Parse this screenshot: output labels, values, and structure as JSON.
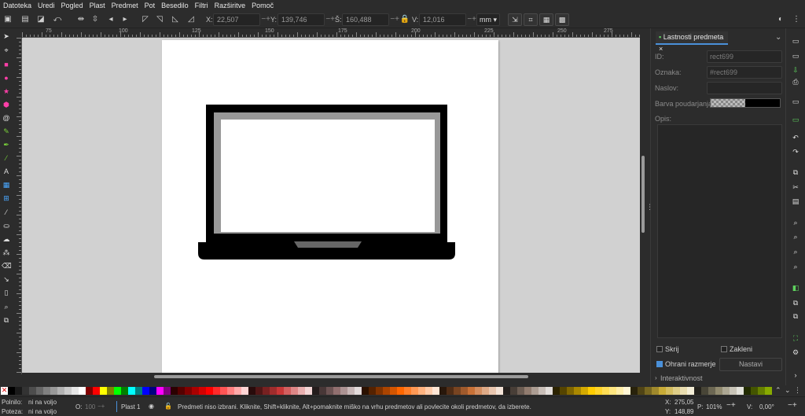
{
  "menu": [
    "Datoteka",
    "Uredi",
    "Pogled",
    "Plast",
    "Predmet",
    "Pot",
    "Besedilo",
    "Filtri",
    "Razširitve",
    "Pomoč"
  ],
  "controls": {
    "x_label": "X:",
    "x_value": "22,507",
    "y_label": "Y:",
    "y_value": "139,746",
    "w_label": "Š:",
    "w_value": "160,488",
    "h_label": "V:",
    "h_value": "12,016",
    "unit": "mm"
  },
  "ruler_top": [
    "75",
    "100",
    "125",
    "150",
    "175",
    "200",
    "225",
    "250",
    "275"
  ],
  "panel": {
    "tab_label": "Lastnosti predmeta",
    "tab_close": "×",
    "id_label": "ID:",
    "id_value": "rect699",
    "oznaka_label": "Oznaka:",
    "oznaka_value": "#rect699",
    "naslov_label": "Naslov:",
    "naslov_value": "",
    "highlight_label": "Barva poudarjanja:",
    "opis_label": "Opis:",
    "skrij": "Skrij",
    "zakleni": "Zakleni",
    "ohrani": "Ohrani razmerje",
    "nastavi": "Nastavi",
    "interaktivnost": "Interaktivnost"
  },
  "status": {
    "fill_label": "Polnilo:",
    "fill_value": "ni na voljo",
    "stroke_label": "Poteza:",
    "stroke_value": "ni na voljo",
    "opacity_label": "O:",
    "opacity_value": "100",
    "layer": "Plast 1",
    "message": "Predmeti niso izbrani. Kliknite, Shift+kliknite, Alt+pomaknite miško na vrhu predmetov ali povlecite okoli predmetov, da izberete.",
    "x_label": "X:",
    "x_value": "275,05",
    "y_label": "Y:",
    "y_value": "148,89",
    "zoom_label": "P:",
    "zoom_value": "101%",
    "rotate_label": "V:",
    "rotate_value": "0,00°"
  },
  "colors": {
    "accent": "#4a90d9",
    "canvas_bg": "#d1d1d1",
    "laptop_body": "#000000",
    "laptop_bezel": "#989898",
    "laptop_trackpad": "#666666"
  },
  "palette": [
    "#000000",
    "#1a1a1a",
    "#333333",
    "#4d4d4d",
    "#666666",
    "#808080",
    "#999999",
    "#b3b3b3",
    "#cccccc",
    "#e6e6e6",
    "#ffffff",
    "#800000",
    "#ff0000",
    "#ffff00",
    "#808000",
    "#00ff00",
    "#008000",
    "#00ffff",
    "#008080",
    "#0000ff",
    "#000080",
    "#ff00ff",
    "#800080",
    "#2b0000",
    "#550000",
    "#800000",
    "#aa0000",
    "#d40000",
    "#ff0000",
    "#ff2a2a",
    "#ff5555",
    "#ff8080",
    "#ffaaaa",
    "#ffd5d5",
    "#280b0b",
    "#501616",
    "#782121",
    "#a02c2c",
    "#c83737",
    "#d35f5f",
    "#de8787",
    "#e9afaf",
    "#f4d7d7",
    "#241c1c",
    "#483737",
    "#6c5353",
    "#916f6f",
    "#ac9393",
    "#c8b7b7",
    "#e3dbdb",
    "#2b1100",
    "#552200",
    "#803300",
    "#aa4400",
    "#d45500",
    "#ff6600",
    "#ff7f2a",
    "#ff9955",
    "#ffb380",
    "#ffccaa",
    "#ffe6d5",
    "#28170b",
    "#502d16",
    "#784421",
    "#a05a2c",
    "#c87137",
    "#d38d5f",
    "#deaa87",
    "#e9c6af",
    "#f4e3d7",
    "#241f1c",
    "#483e37",
    "#6c5d53",
    "#917c6f",
    "#ac9d93",
    "#c8beb7",
    "#e3dedb",
    "#2b2200",
    "#554400",
    "#806600",
    "#aa8800",
    "#d4aa00",
    "#ffcc00",
    "#ffd42a",
    "#ffdd55",
    "#ffe680",
    "#ffeeaa",
    "#fff6d5",
    "#28220b",
    "#504416",
    "#786721",
    "#a0892c",
    "#c8ab37",
    "#d3bc5f",
    "#decd87",
    "#e9ddaf",
    "#f4eed7",
    "#24221c",
    "#484537",
    "#6c6753",
    "#918a6f",
    "#aca793",
    "#c8c4b7",
    "#e3e2db",
    "#222b00",
    "#445500",
    "#668000",
    "#88aa00",
    "#aad400",
    "#ccff00"
  ]
}
